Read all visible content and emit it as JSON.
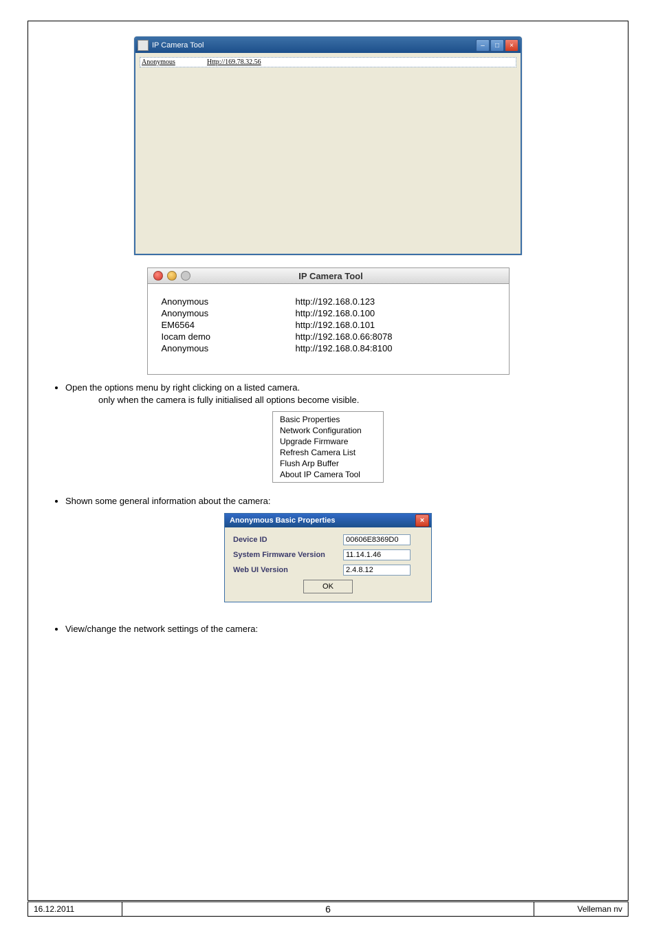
{
  "win_screenshot": {
    "title": "IP Camera Tool",
    "row": {
      "name": "Anonymous",
      "addr": "Http://169.78.32.56"
    }
  },
  "mac_screenshot": {
    "title": "IP Camera Tool",
    "rows": [
      {
        "name": "Anonymous",
        "addr": "http://192.168.0.123"
      },
      {
        "name": "Anonymous",
        "addr": "http://192.168.0.100"
      },
      {
        "name": "EM6564",
        "addr": "http://192.168.0.101"
      },
      {
        "name": "Iocam demo",
        "addr": "http://192.168.0.66:8078"
      },
      {
        "name": "Anonymous",
        "addr": "http://192.168.0.84:8100"
      }
    ]
  },
  "bullets": {
    "b1": "Open the options menu by right clicking on a listed camera.",
    "b1_sub": "only when the camera is fully initialised all options become visible.",
    "b2": "Shown some general information about the camera:",
    "b3": "View/change the network settings of the camera:"
  },
  "context_menu": {
    "items": [
      "Basic Properties",
      "Network Configuration",
      "Upgrade Firmware",
      "Refresh Camera List",
      "Flush Arp Buffer",
      "About IP Camera Tool"
    ]
  },
  "prop_dialog": {
    "title": "Anonymous Basic Properties",
    "rows": [
      {
        "label": "Device ID",
        "value": "00606E8369D0"
      },
      {
        "label": "System Firmware Version",
        "value": "11.14.1.46"
      },
      {
        "label": "Web UI Version",
        "value": "2.4.8.12"
      }
    ],
    "ok": "OK"
  },
  "footer": {
    "date": "16.12.2011",
    "page": "6",
    "org": "Velleman nv"
  }
}
